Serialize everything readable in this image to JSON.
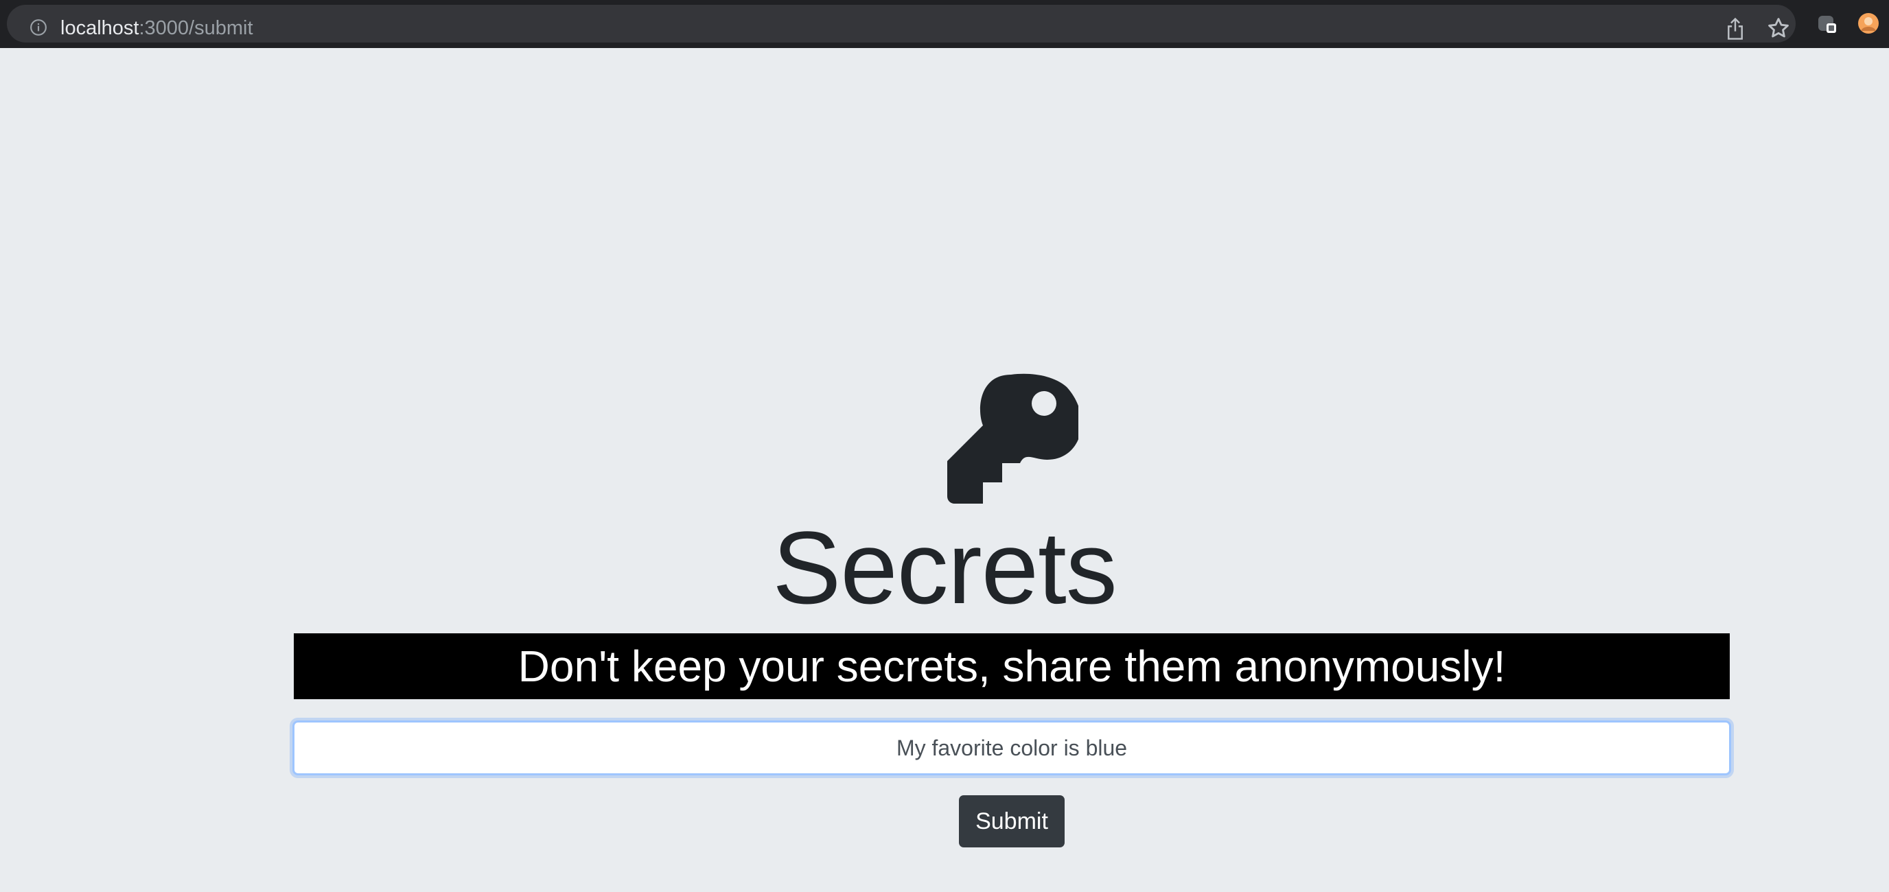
{
  "browser": {
    "url_host": "localhost",
    "url_path": ":3000/submit",
    "icons": {
      "info": "info-icon",
      "share": "share-icon",
      "bookmark": "star-icon",
      "extension": "extension-icon",
      "profile": "profile-avatar-icon"
    }
  },
  "page": {
    "logo_icon": "key-icon",
    "title": "Secrets",
    "banner_text": "Don't keep your secrets, share them anonymously!",
    "secret_input_value": "My favorite color is blue",
    "submit_label": "Submit"
  },
  "colors": {
    "background": "#e9ecef",
    "banner_bg": "#000000",
    "button_bg": "#343a40",
    "text_dark": "#212529",
    "input_focus_border": "#9ec5fe"
  }
}
